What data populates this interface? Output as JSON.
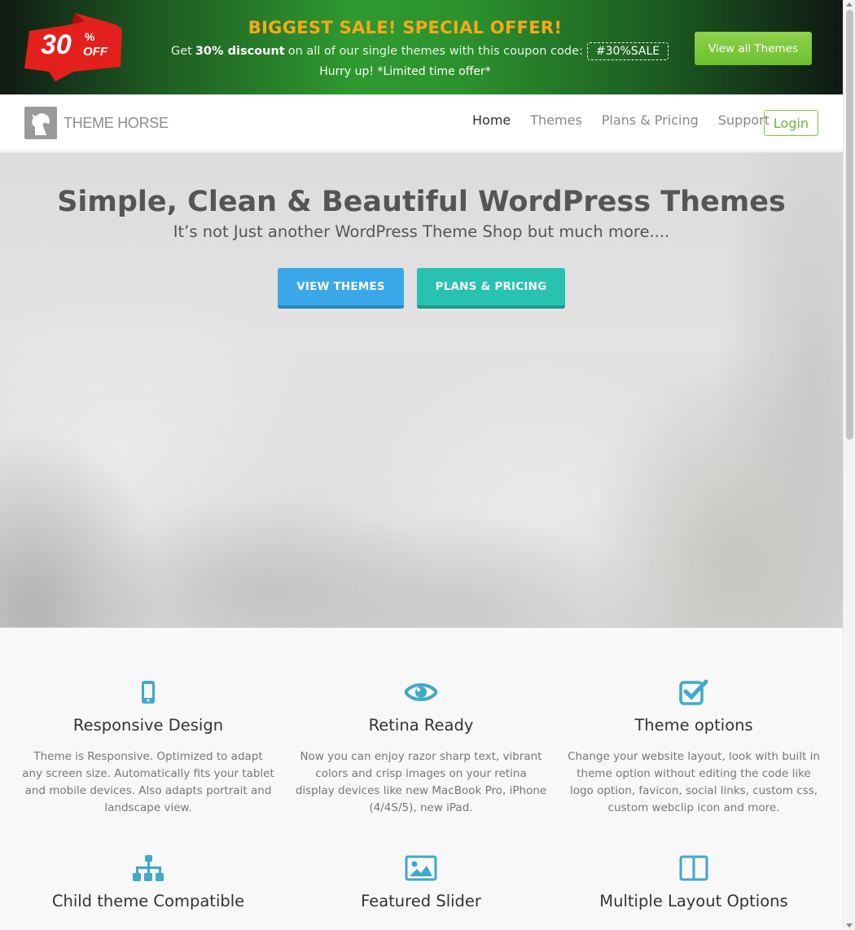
{
  "promo": {
    "badge_value": "30",
    "badge_percent": "%",
    "badge_off": "OFF",
    "title": "BIGGEST SALE! SPECIAL OFFER!",
    "line_prefix": "Get",
    "line_bold": "30% discount",
    "line_suffix": "on all of our single themes with this coupon code:",
    "coupon": "#30%SALE",
    "hurry": "Hurry up! *Limited time offer*",
    "view_all_label": "View all Themes"
  },
  "header": {
    "logo_text": "THEME HORSE",
    "nav": [
      {
        "label": "Home"
      },
      {
        "label": "Themes"
      },
      {
        "label": "Plans & Pricing"
      },
      {
        "label": "Support"
      }
    ],
    "login_label": "Login"
  },
  "hero": {
    "title": "Simple, Clean & Beautiful WordPress Themes",
    "subtitle": "It’s not Just another WordPress Theme Shop but much more....",
    "btn_themes": "VIEW THEMES",
    "btn_plans": "PLANS & PRICING"
  },
  "features": [
    {
      "icon": "mobile-icon",
      "title": "Responsive Design",
      "text": "Theme is Responsive. Optimized to adapt any screen size. Automatically fits your tablet and mobile devices. Also adapts portrait and landscape view."
    },
    {
      "icon": "eye-icon",
      "title": "Retina Ready",
      "text": "Now you can enjoy razor sharp text, vibrant colors and crisp images on your retina display devices like new MacBook Pro, iPhone (4/4S/5), new iPad."
    },
    {
      "icon": "checkbox-icon",
      "title": "Theme options",
      "text": "Change your website layout, look with built in theme option without editing the code like logo option, favicon, social links, custom css, custom webclip icon and more."
    },
    {
      "icon": "sitemap-icon",
      "title": "Child theme Compatible"
    },
    {
      "icon": "image-icon",
      "title": "Featured Slider"
    },
    {
      "icon": "columns-icon",
      "title": "Multiple Layout Options"
    }
  ],
  "colors": {
    "accent_blue": "#3aa8e8",
    "accent_teal": "#27c2b0",
    "icon_color": "#3fa9c9",
    "promo_orange": "#f7a81b",
    "login_green": "#6cb53a"
  }
}
